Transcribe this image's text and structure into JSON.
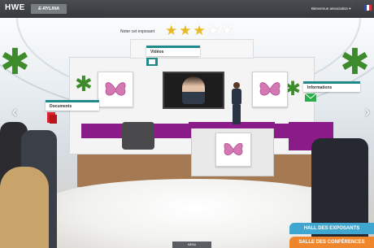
{
  "header": {
    "brand": "HWE",
    "brand_sub": "E-RYLINA",
    "welcome": "Bienvenue association",
    "welcome_caret": "▾"
  },
  "rating": {
    "label": "Noter cet exposant",
    "stars_filled": 3,
    "stars_total": 5
  },
  "stand": {
    "videos_label": "Vidéos",
    "documents_label": "Documents",
    "informations_label": "Informations"
  },
  "nav": {
    "left_arrow": "‹",
    "right_arrow": "›"
  },
  "bottom": {
    "hall_label": "HALL DES EXPOSANTS",
    "conferences_label": "SALLE DES CONFÉRENCES",
    "menu_label": "MENU"
  },
  "colors": {
    "accent_purple": "#8c1b8a",
    "hall_blue": "#3ea6cf",
    "conf_orange": "#f0862c",
    "tab_teal": "#1f8a8a"
  }
}
